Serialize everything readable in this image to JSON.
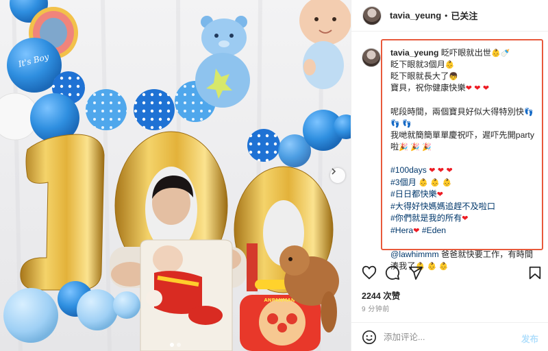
{
  "post": {
    "username": "tavia_yeung",
    "follow_status": "已关注",
    "dot": "•"
  },
  "caption": {
    "username": "tavia_yeung",
    "lines": {
      "l1": "眨吓眼就出世",
      "l2": "眨下眼就3個月",
      "l3": "眨下眼就長大了",
      "l4": "寶貝，祝你健康快樂",
      "l5": "呢段時間，兩個寶貝好似大得特別快",
      "l6": "我哋就簡簡單單慶祝吓，遲吓先開party",
      "l7": "啦",
      "h1": "#100days",
      "h2": "#3個月",
      "h3": "#日日都快樂",
      "h4": "#大得好快媽媽追趕不及啦口",
      "h5": "#你們就是我的所有",
      "h6a": "#Hera",
      "h6b": "#Eden",
      "mention": "@lawhimmm",
      "m1": "爸爸就快要工作，有時間",
      "m2": "湊我了"
    },
    "emoji": {
      "baby": "👶",
      "bottle": "🍼",
      "boy": "👦",
      "heart": "❤",
      "feet": "👣",
      "party": "🎉"
    }
  },
  "engagement": {
    "likes": "2244 次赞",
    "time": "9 分钟前"
  },
  "comment": {
    "placeholder": "添加评论...",
    "post_label": "发布"
  },
  "photo": {
    "balloon_text": "It's Boy",
    "toy_text": "ANPANMAN",
    "number_shown": "100"
  },
  "colors": {
    "highlight_border": "#e8593b",
    "gold": "#e3b23a",
    "balloon_blue": "#2f8fe0",
    "link_blue": "#00376b",
    "post_button": "#b2dffc"
  }
}
